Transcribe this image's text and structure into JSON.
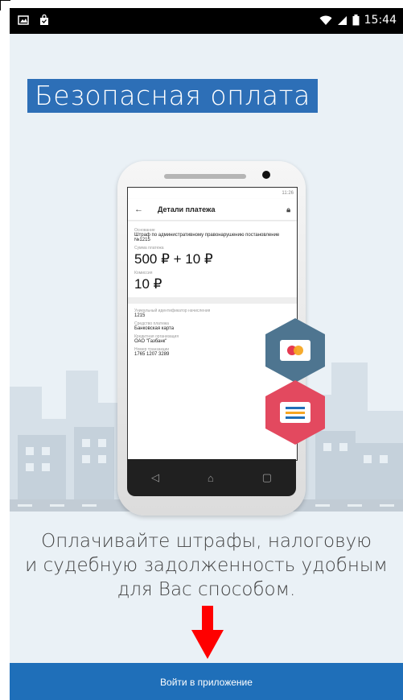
{
  "status_bar": {
    "time": "15:44"
  },
  "title": "Безопасная оплата",
  "phone": {
    "status_time": "11:26",
    "header_title": "Детали платежа",
    "fields": [
      {
        "label": "Основание",
        "value": "Штраф по административному правонарушению постановление №1215"
      },
      {
        "label": "Сумма платежа",
        "value": "500 ₽ + 10 ₽"
      },
      {
        "label": "Комиссия",
        "value": "10 ₽"
      },
      {
        "label": "Уникальный идентификатор начисления",
        "value": "1215"
      },
      {
        "label": "Средство платежа",
        "value": "Банковская карта"
      },
      {
        "label": "Кредитная организация",
        "value": "ОАО \"Газбанк\""
      },
      {
        "label": "Номер транзакции",
        "value": "1765 1207 3289"
      }
    ]
  },
  "subtitle": {
    "line1": "Оплачивайте штрафы, налоговую",
    "line2": "и судебную задолженность удобным",
    "line3": "для Вас способом."
  },
  "login_button": "Войти в приложение",
  "colors": {
    "accent": "#1f6fb9",
    "title_bg": "#2d6fb7",
    "hex_blue": "#4e7590",
    "hex_red": "#e3495f",
    "arrow": "#ff0000"
  }
}
